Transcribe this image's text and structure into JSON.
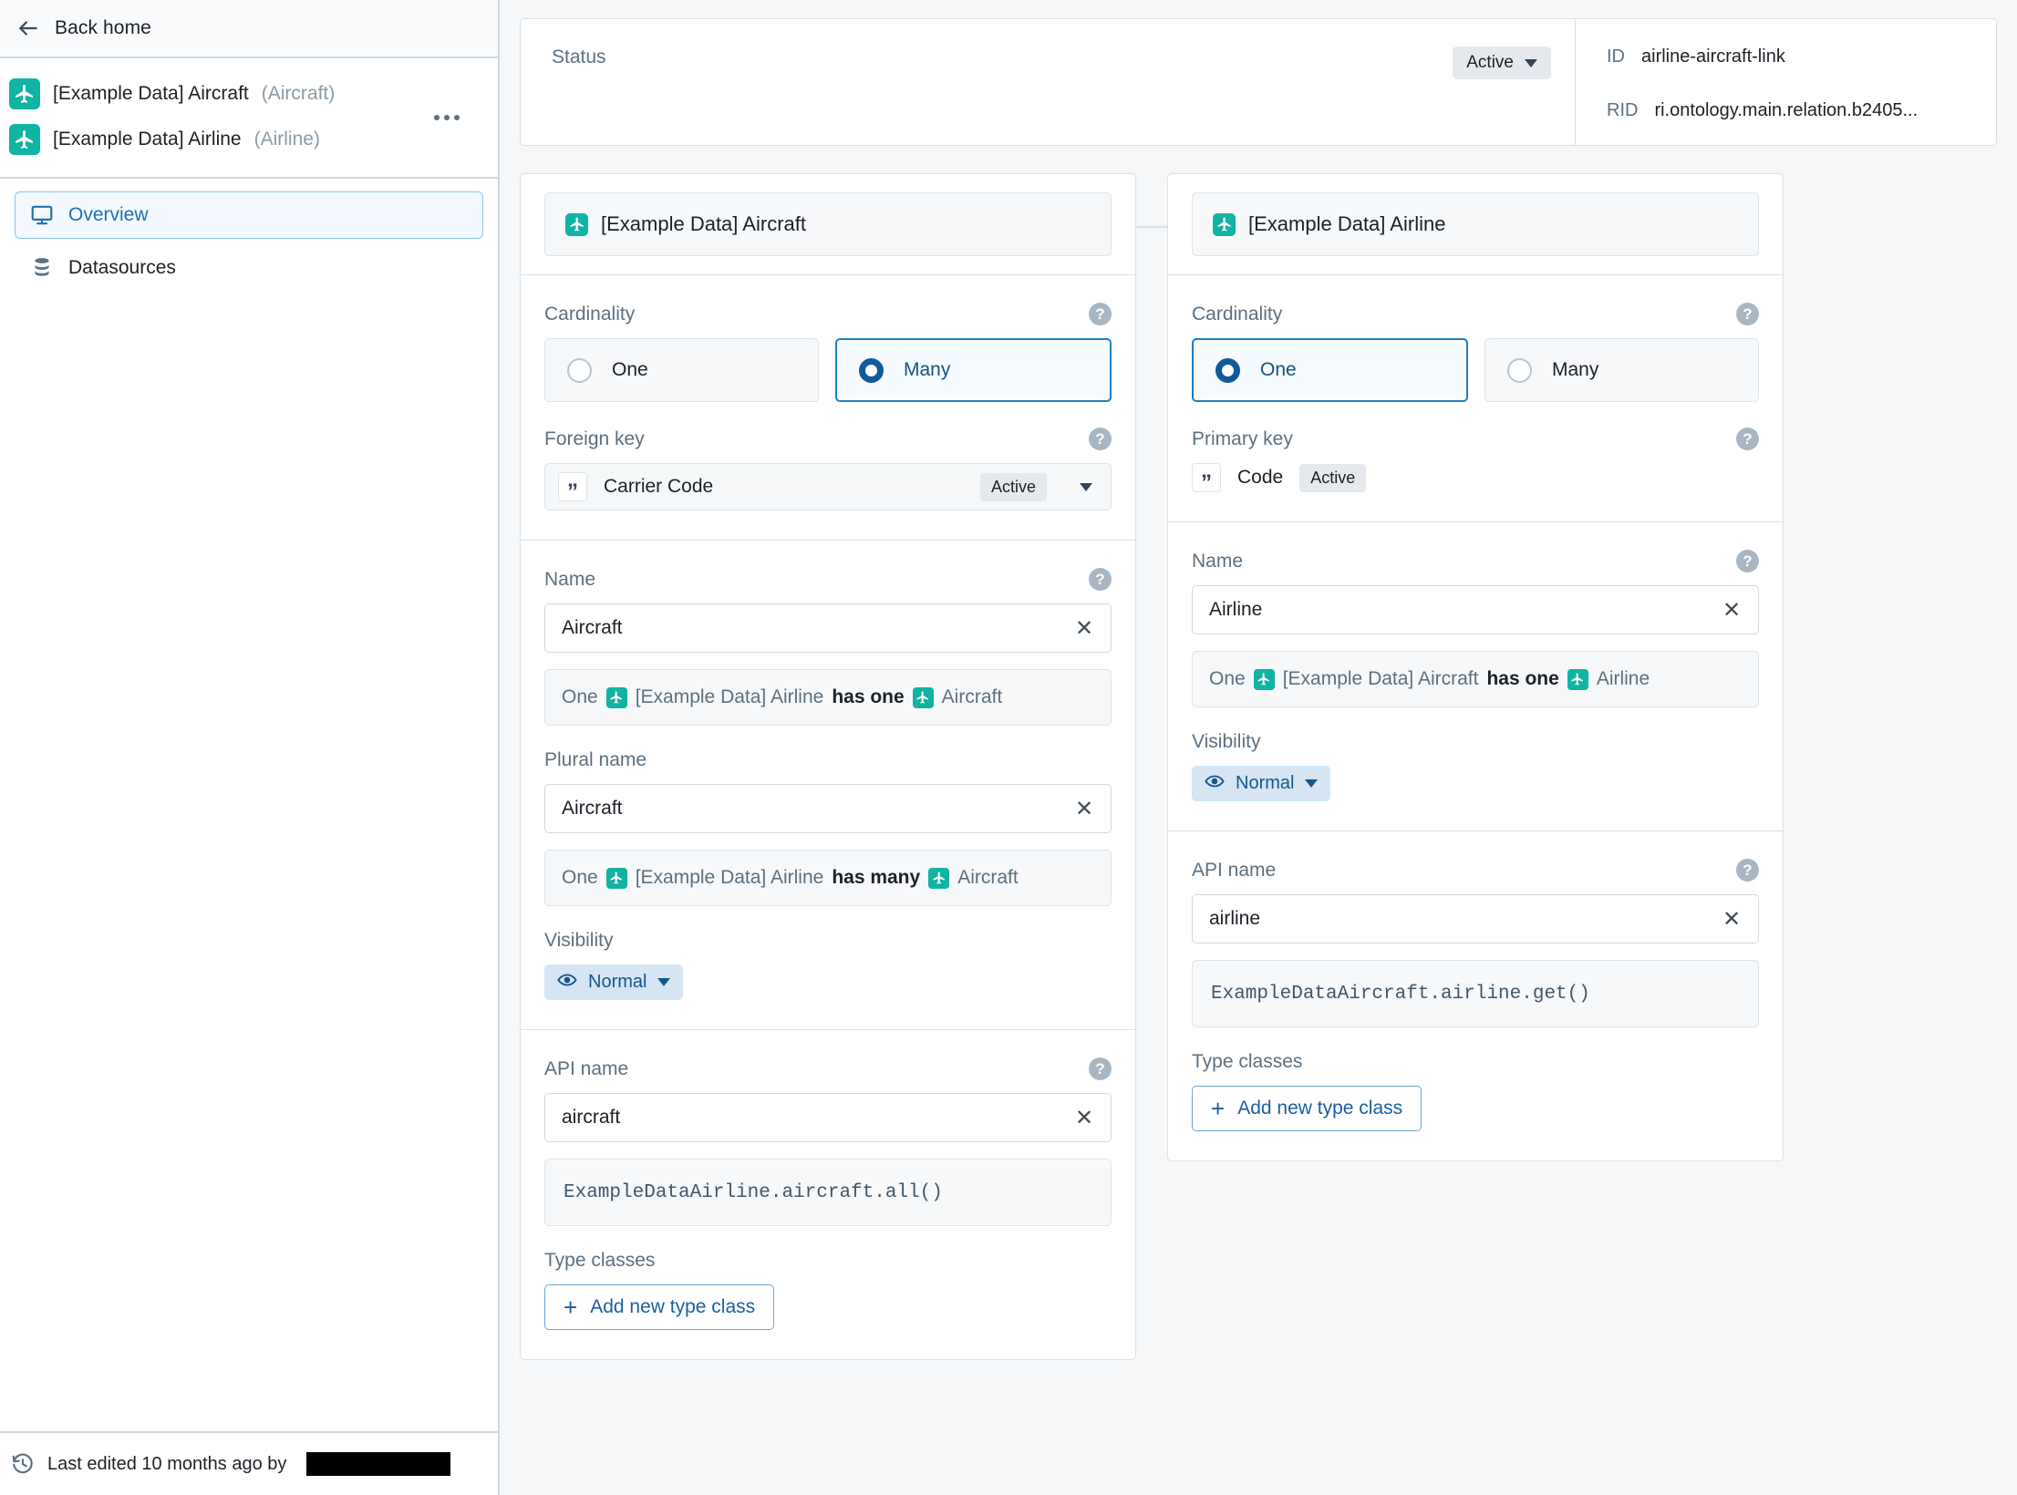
{
  "sidebar": {
    "back_label": "Back home",
    "back_icon": "arrow-left-icon",
    "entities": [
      {
        "icon": "airplane-icon",
        "name": "[Example Data] Aircraft",
        "api": "(Aircraft)"
      },
      {
        "icon": "airplane-icon",
        "name": "[Example Data] Airline",
        "api": "(Airline)"
      }
    ],
    "more_icon": "more-horizontal-icon",
    "nav": [
      {
        "icon": "monitor-icon",
        "label": "Overview",
        "active": true
      },
      {
        "icon": "database-icon",
        "label": "Datasources",
        "active": false
      }
    ],
    "footer": {
      "icon": "history-icon",
      "text": "Last edited 10 months ago by",
      "author_redacted": true
    }
  },
  "status_card": {
    "label": "Status",
    "value": "Active",
    "caret_icon": "chevron-down-icon",
    "meta": [
      {
        "key": "ID",
        "value": "airline-aircraft-link"
      },
      {
        "key": "RID",
        "value": "ri.ontology.main.relation.b2405..."
      }
    ]
  },
  "left_card": {
    "object_icon": "airplane-icon",
    "object_title": "[Example Data] Aircraft",
    "cardinality": {
      "label": "Cardinality",
      "help_icon": "help-circle-icon",
      "options": [
        {
          "label": "One",
          "selected": false
        },
        {
          "label": "Many",
          "selected": true
        }
      ]
    },
    "key": {
      "label": "Foreign key",
      "help_icon": "help-circle-icon",
      "icon": "quote-icon",
      "name": "Carrier Code",
      "badge": "Active",
      "caret_icon": "chevron-down-icon"
    },
    "name": {
      "label": "Name",
      "help_icon": "help-circle-icon",
      "value": "Aircraft",
      "clear_icon": "close-icon",
      "preview": {
        "prefix": "One",
        "subject_icon": "airplane-icon",
        "subject": "[Example Data] Airline",
        "verb": "has one",
        "object_icon": "airplane-icon",
        "object": "Aircraft"
      }
    },
    "plural_name": {
      "label": "Plural name",
      "value": "Aircraft",
      "clear_icon": "close-icon",
      "preview": {
        "prefix": "One",
        "subject_icon": "airplane-icon",
        "subject": "[Example Data] Airline",
        "verb": "has many",
        "object_icon": "airplane-icon",
        "object": "Aircraft"
      }
    },
    "visibility": {
      "label": "Visibility",
      "value": "Normal",
      "icon": "eye-icon",
      "caret_icon": "chevron-down-icon"
    },
    "api_name": {
      "label": "API name",
      "help_icon": "help-circle-icon",
      "value": "aircraft",
      "clear_icon": "close-icon",
      "snippet": "ExampleDataAirline.aircraft.all()"
    },
    "type_classes": {
      "label": "Type classes",
      "add_label": "Add new type class",
      "add_icon": "plus-icon"
    }
  },
  "right_card": {
    "object_icon": "airplane-icon",
    "object_title": "[Example Data] Airline",
    "cardinality": {
      "label": "Cardinality",
      "help_icon": "help-circle-icon",
      "options": [
        {
          "label": "One",
          "selected": true
        },
        {
          "label": "Many",
          "selected": false
        }
      ]
    },
    "key": {
      "label": "Primary key",
      "help_icon": "help-circle-icon",
      "icon": "quote-icon",
      "name": "Code",
      "badge": "Active"
    },
    "name": {
      "label": "Name",
      "help_icon": "help-circle-icon",
      "value": "Airline",
      "clear_icon": "close-icon",
      "preview": {
        "prefix": "One",
        "subject_icon": "airplane-icon",
        "subject": "[Example Data] Aircraft",
        "verb": "has one",
        "object_icon": "airplane-icon",
        "object": "Airline"
      }
    },
    "visibility": {
      "label": "Visibility",
      "value": "Normal",
      "icon": "eye-icon",
      "caret_icon": "chevron-down-icon"
    },
    "api_name": {
      "label": "API name",
      "help_icon": "help-circle-icon",
      "value": "airline",
      "clear_icon": "close-icon",
      "snippet": "ExampleDataAircraft.airline.get()"
    },
    "type_classes": {
      "label": "Type classes",
      "add_label": "Add new type class",
      "add_icon": "plus-icon"
    }
  },
  "colors": {
    "teal": "#11b3a3",
    "accent_blue": "#1f7fc4",
    "canvas": "#f5f7f9",
    "border": "#d8e1e8"
  }
}
